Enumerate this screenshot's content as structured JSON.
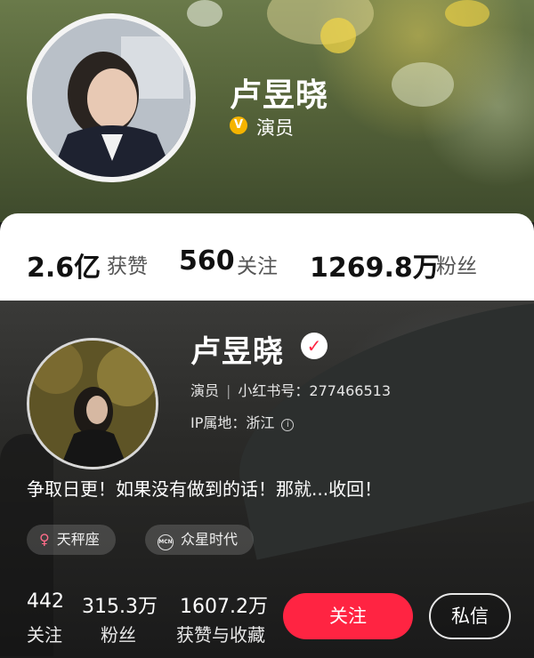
{
  "top_profile": {
    "name": "卢昱晓",
    "verified_icon": "v-badge-icon",
    "role": "演员"
  },
  "top_stats": [
    {
      "value": "2.6亿",
      "label": "获赞"
    },
    {
      "value": "560",
      "label": "关注"
    },
    {
      "value": "1269.8万",
      "label": "粉丝"
    }
  ],
  "profile": {
    "name": "卢昱晓",
    "verified_icon": "red-check-icon",
    "role": "演员",
    "id_label": "小红书号：277466513",
    "ip_label": "IP属地：浙江",
    "bio": "争取日更！如果没有做到的话！那就...收回！"
  },
  "tags": [
    {
      "icon": "female-symbol-icon",
      "glyph": "♀",
      "label": "天秤座"
    },
    {
      "icon": "mcn-icon",
      "glyph": "MCN",
      "label": "众星时代"
    }
  ],
  "stats": [
    {
      "value": "442",
      "label": "关注"
    },
    {
      "value": "315.3万",
      "label": "粉丝"
    },
    {
      "value": "1607.2万",
      "label": "获赞与收藏"
    }
  ],
  "actions": {
    "follow_label": "关注",
    "message_label": "私信"
  },
  "colors": {
    "accent_red": "#ff2442",
    "badge_gold": "#f5b400"
  }
}
